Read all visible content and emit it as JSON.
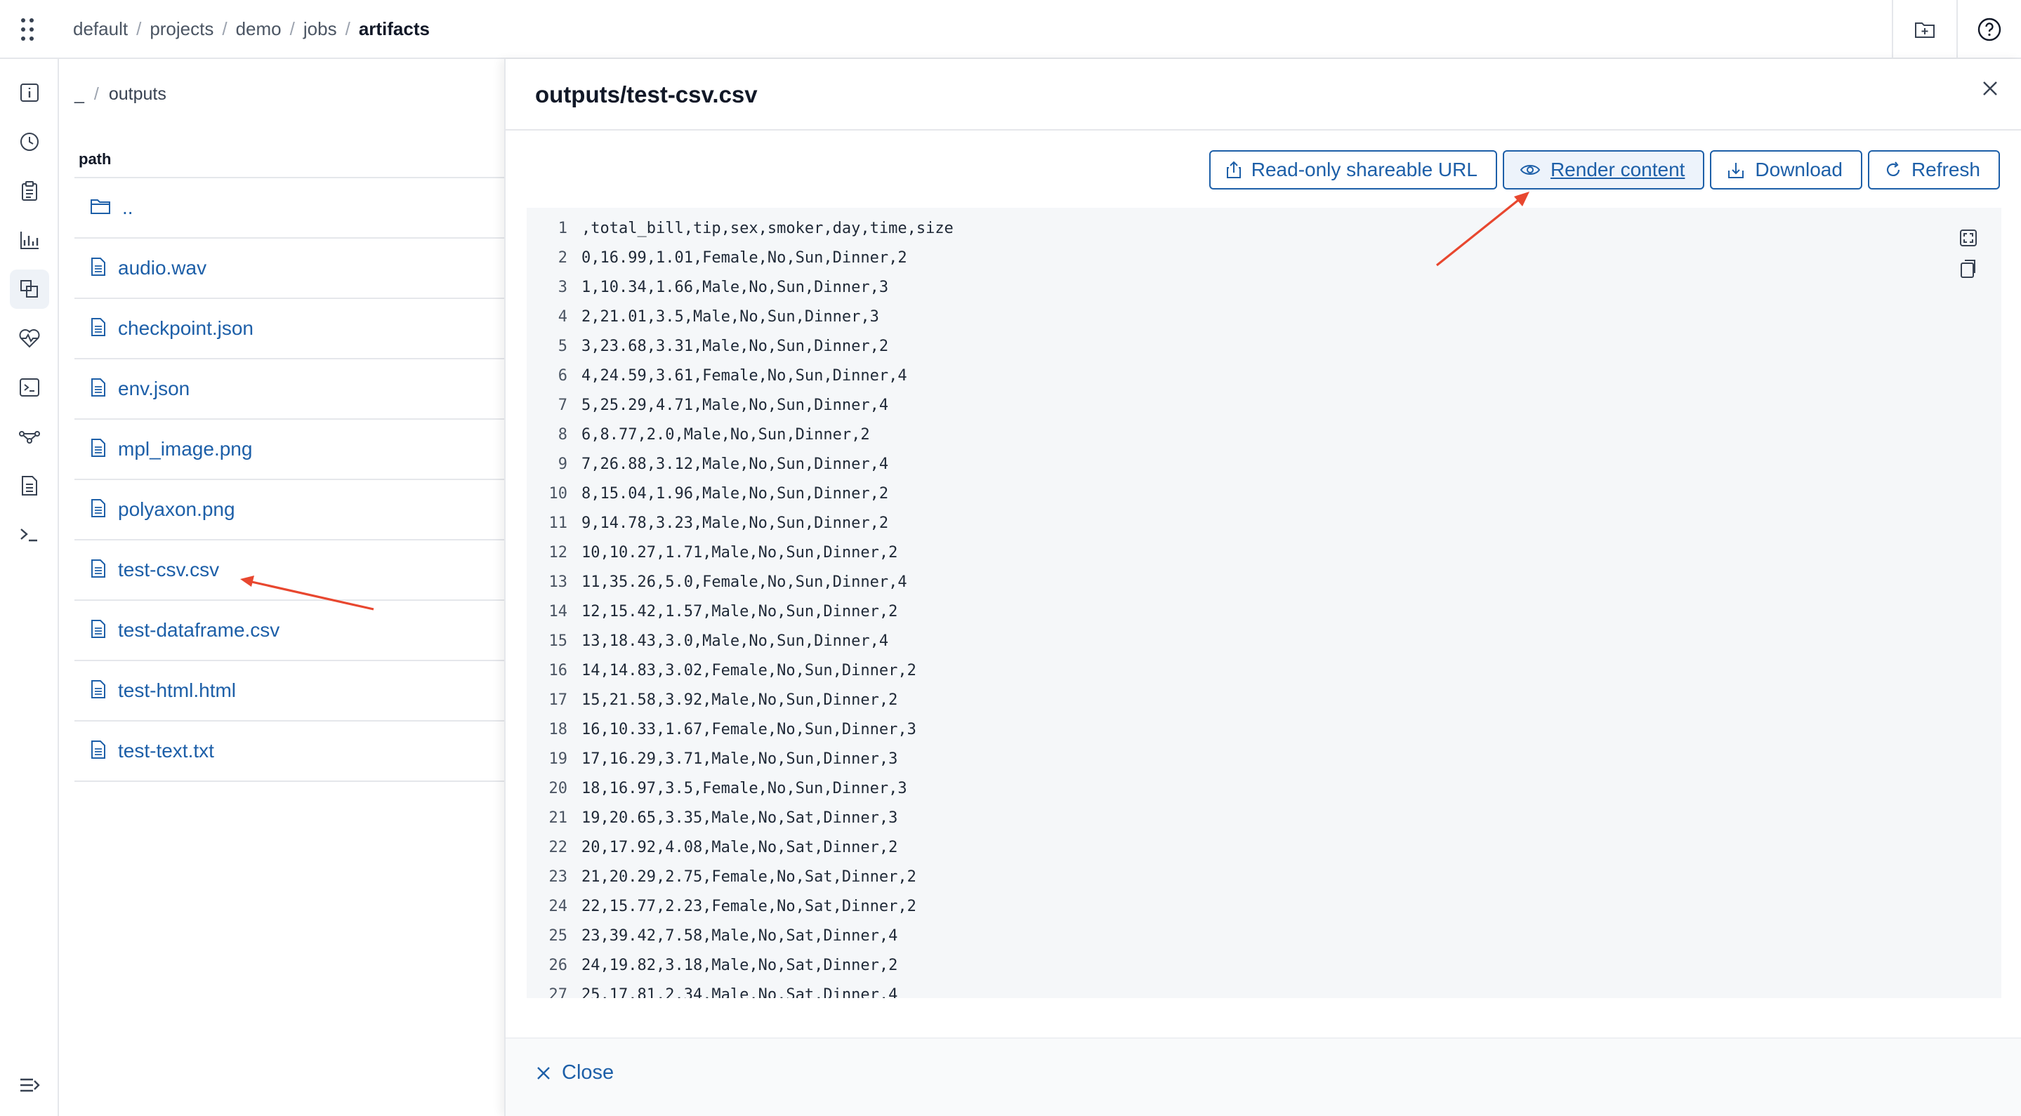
{
  "breadcrumb": [
    "default",
    "projects",
    "demo",
    "jobs",
    "artifacts"
  ],
  "files": {
    "breadcrumb_root": "_",
    "breadcrumb_dir": "outputs",
    "column_header": "path",
    "items": [
      {
        "name": "..",
        "type": "folder"
      },
      {
        "name": "audio.wav",
        "type": "file"
      },
      {
        "name": "checkpoint.json",
        "type": "file"
      },
      {
        "name": "env.json",
        "type": "file"
      },
      {
        "name": "mpl_image.png",
        "type": "file"
      },
      {
        "name": "polyaxon.png",
        "type": "file"
      },
      {
        "name": "test-csv.csv",
        "type": "file"
      },
      {
        "name": "test-dataframe.csv",
        "type": "file"
      },
      {
        "name": "test-html.html",
        "type": "file"
      },
      {
        "name": "test-text.txt",
        "type": "file"
      }
    ]
  },
  "drawer": {
    "title": "outputs/test-csv.csv",
    "buttons": {
      "share": "Read-only shareable URL",
      "render": "Render content",
      "download": "Download",
      "refresh": "Refresh"
    },
    "close_label": "Close"
  },
  "code_lines": [
    ",total_bill,tip,sex,smoker,day,time,size",
    "0,16.99,1.01,Female,No,Sun,Dinner,2",
    "1,10.34,1.66,Male,No,Sun,Dinner,3",
    "2,21.01,3.5,Male,No,Sun,Dinner,3",
    "3,23.68,3.31,Male,No,Sun,Dinner,2",
    "4,24.59,3.61,Female,No,Sun,Dinner,4",
    "5,25.29,4.71,Male,No,Sun,Dinner,4",
    "6,8.77,2.0,Male,No,Sun,Dinner,2",
    "7,26.88,3.12,Male,No,Sun,Dinner,4",
    "8,15.04,1.96,Male,No,Sun,Dinner,2",
    "9,14.78,3.23,Male,No,Sun,Dinner,2",
    "10,10.27,1.71,Male,No,Sun,Dinner,2",
    "11,35.26,5.0,Female,No,Sun,Dinner,4",
    "12,15.42,1.57,Male,No,Sun,Dinner,2",
    "13,18.43,3.0,Male,No,Sun,Dinner,4",
    "14,14.83,3.02,Female,No,Sun,Dinner,2",
    "15,21.58,3.92,Male,No,Sun,Dinner,2",
    "16,10.33,1.67,Female,No,Sun,Dinner,3",
    "17,16.29,3.71,Male,No,Sun,Dinner,3",
    "18,16.97,3.5,Female,No,Sun,Dinner,3",
    "19,20.65,3.35,Male,No,Sat,Dinner,3",
    "20,17.92,4.08,Male,No,Sat,Dinner,2",
    "21,20.29,2.75,Female,No,Sat,Dinner,2",
    "22,15.77,2.23,Female,No,Sat,Dinner,2",
    "23,39.42,7.58,Male,No,Sat,Dinner,4",
    "24,19.82,3.18,Male,No,Sat,Dinner,2",
    "25,17.81,2.34,Male,No,Sat,Dinner,4"
  ],
  "colors": {
    "link": "#1d5fa8",
    "annotation_arrow": "#e8472f",
    "code_bg": "#f5f7f9"
  },
  "icons": {
    "topbar": [
      "grid-menu-icon",
      "folder-add-icon",
      "help-icon"
    ],
    "nav": [
      "info-icon",
      "history-icon",
      "clipboard-icon",
      "chart-icon",
      "artifacts-icon",
      "heart-pulse-icon",
      "terminal-box-icon",
      "dag-icon",
      "document-icon",
      "terminal-icon",
      "expand-menu-icon"
    ]
  }
}
